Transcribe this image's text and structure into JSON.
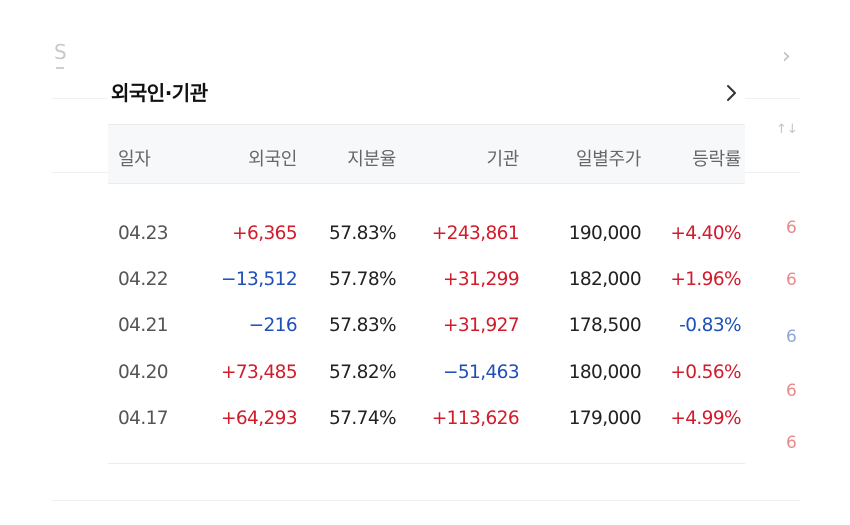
{
  "background": {
    "right_fragment_text": "↑↓",
    "right_digits": [
      "6",
      "6",
      "6",
      "6",
      "6"
    ],
    "right_digit_colors": [
      "#e88a8a",
      "#e88a8a",
      "#8fa7d6",
      "#e88a8a",
      "#e88a8a"
    ]
  },
  "panel": {
    "title": "외국인·기관",
    "more_icon": "chevron-right-icon",
    "columns": [
      "일자",
      "외국인",
      "지분율",
      "기관",
      "일별주가",
      "등락률"
    ],
    "rows": [
      {
        "date": "04.23",
        "foreign": "+6,365",
        "foreign_dir": "up",
        "share": "57.83%",
        "inst": "+243,861",
        "inst_dir": "up",
        "price": "190,000",
        "rate": "+4.40%",
        "rate_dir": "up"
      },
      {
        "date": "04.22",
        "foreign": "−13,512",
        "foreign_dir": "down",
        "share": "57.78%",
        "inst": "+31,299",
        "inst_dir": "up",
        "price": "182,000",
        "rate": "+1.96%",
        "rate_dir": "up"
      },
      {
        "date": "04.21",
        "foreign": "−216",
        "foreign_dir": "down",
        "share": "57.83%",
        "inst": "+31,927",
        "inst_dir": "up",
        "price": "178,500",
        "rate": "-0.83%",
        "rate_dir": "down"
      },
      {
        "date": "04.20",
        "foreign": "+73,485",
        "foreign_dir": "up",
        "share": "57.82%",
        "inst": "−51,463",
        "inst_dir": "down",
        "price": "180,000",
        "rate": "+0.56%",
        "rate_dir": "up"
      },
      {
        "date": "04.17",
        "foreign": "+64,293",
        "foreign_dir": "up",
        "share": "57.74%",
        "inst": "+113,626",
        "inst_dir": "up",
        "price": "179,000",
        "rate": "+4.99%",
        "rate_dir": "up"
      }
    ]
  },
  "colors": {
    "up": "#d21b2b",
    "down": "#1f4fb8",
    "header_bg": "#f7f8fa"
  }
}
